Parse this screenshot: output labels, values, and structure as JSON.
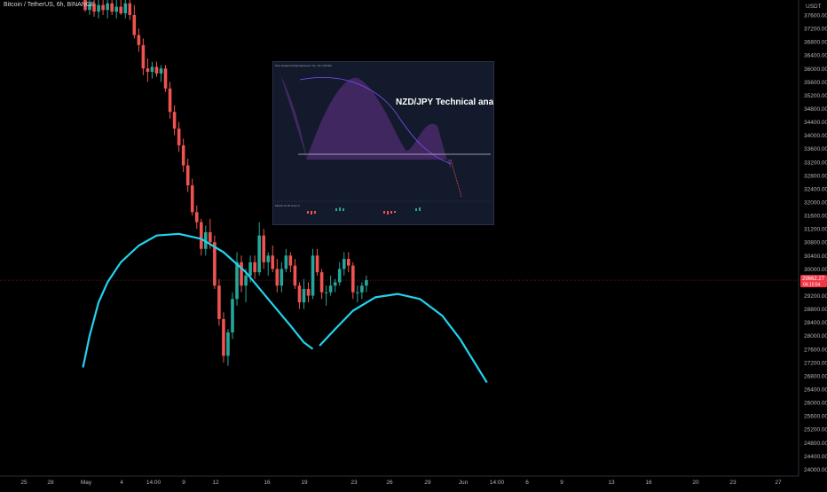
{
  "symbol_title": "Bitcoin / TetherUS, 6h, BINANCE",
  "currency": "USDT",
  "last_price": "29662.27",
  "last_sub": "04:15:54",
  "inset": {
    "title": "NZD/JPY Technical analysis",
    "header": "New Zealand Dollar/Japanese Yen, 1D, OANDA",
    "indicator": "MACD 12 26 close 9"
  },
  "colors": {
    "background": "#000000",
    "up": "#26a69a",
    "down": "#ef5350",
    "projection": "#22d3ee",
    "axis_text": "#b2b5be",
    "price_tag": "#f23645"
  },
  "chart_data": {
    "type": "candlestick",
    "y_axis": {
      "ticks": [
        24000,
        24400,
        24800,
        25200,
        25600,
        26000,
        26400,
        26800,
        27200,
        27600,
        28000,
        28400,
        28800,
        29200,
        29600,
        30000,
        30400,
        30800,
        31200,
        31600,
        32000,
        32400,
        32800,
        33200,
        33600,
        34000,
        34400,
        34800,
        35200,
        35600,
        36000,
        36400,
        36800,
        37200,
        37600
      ],
      "tick_labels": [
        "24000.00",
        "24400.00",
        "24800.00",
        "25200.00",
        "25600.00",
        "26000.00",
        "26400.00",
        "26800.00",
        "27200.00",
        "27600.00",
        "28000.00",
        "28400.00",
        "28800.00",
        "29200.00",
        "29600.00",
        "30000.00",
        "30400.00",
        "30800.00",
        "31200.00",
        "31600.00",
        "32000.00",
        "32400.00",
        "32800.00",
        "33200.00",
        "33600.00",
        "34000.00",
        "34400.00",
        "34800.00",
        "35200.00",
        "35600.00",
        "36000.00",
        "36400.00",
        "36800.00",
        "37200.00",
        "37600.00"
      ],
      "range": [
        23800,
        38050
      ]
    },
    "x_axis": {
      "labels": [
        "25",
        "28",
        "May",
        "4",
        "14:00",
        "9",
        "12",
        "16",
        "19",
        "23",
        "26",
        "29",
        "Jun",
        "14:00",
        "6",
        "9",
        "13",
        "16",
        "20",
        "23",
        "27"
      ],
      "dates": [
        "2021-04-25",
        "2021-04-28",
        "2021-05-01",
        "2021-05-04",
        "2021-05-07 14:00",
        "2021-05-09",
        "2021-05-12",
        "2021-05-16",
        "2021-05-19",
        "2021-05-23",
        "2021-05-26",
        "2021-05-29",
        "2021-06-01",
        "2021-06-03 14:00",
        "2021-06-06",
        "2021-06-09",
        "2021-06-13",
        "2021-06-16",
        "2021-06-20",
        "2021-06-23",
        "2021-06-27"
      ]
    },
    "candles": [
      [
        38050,
        38050,
        37700,
        37750
      ],
      [
        37750,
        38050,
        37600,
        37950
      ],
      [
        37950,
        38050,
        37550,
        37700
      ],
      [
        37700,
        38050,
        37500,
        37900
      ],
      [
        37900,
        38050,
        37600,
        37750
      ],
      [
        37750,
        38050,
        37500,
        37950
      ],
      [
        37950,
        38050,
        37600,
        37700
      ],
      [
        37700,
        38050,
        37500,
        37850
      ],
      [
        37850,
        38050,
        37600,
        37650
      ],
      [
        37650,
        38050,
        37500,
        37950
      ],
      [
        37950,
        38050,
        37450,
        37600
      ],
      [
        37600,
        37900,
        36900,
        37000
      ],
      [
        37000,
        37200,
        36500,
        36700
      ],
      [
        36700,
        36900,
        35800,
        36000
      ],
      [
        36000,
        36300,
        35600,
        35900
      ],
      [
        35900,
        36200,
        35700,
        36050
      ],
      [
        36050,
        36200,
        35750,
        35850
      ],
      [
        35850,
        36100,
        35600,
        36000
      ],
      [
        36000,
        36100,
        35300,
        35400
      ],
      [
        35400,
        35600,
        34500,
        34700
      ],
      [
        34700,
        34900,
        34000,
        34200
      ],
      [
        34200,
        34400,
        33500,
        33700
      ],
      [
        33700,
        33900,
        32900,
        33100
      ],
      [
        33100,
        33300,
        32300,
        32500
      ],
      [
        32500,
        32700,
        31600,
        31700
      ],
      [
        31700,
        31900,
        31200,
        31400
      ],
      [
        31400,
        31500,
        30400,
        30600
      ],
      [
        30600,
        31300,
        30400,
        31100
      ],
      [
        31100,
        31500,
        30600,
        30800
      ],
      [
        30800,
        31000,
        29400,
        29500
      ],
      [
        29500,
        29700,
        28300,
        28500
      ],
      [
        28500,
        28700,
        27200,
        27400
      ],
      [
        27400,
        28200,
        27100,
        28100
      ],
      [
        28100,
        29300,
        27900,
        29100
      ],
      [
        29100,
        30500,
        28900,
        30200
      ],
      [
        30200,
        30400,
        29300,
        29500
      ],
      [
        29500,
        30000,
        29000,
        29800
      ],
      [
        29800,
        30400,
        29600,
        30200
      ],
      [
        30200,
        30400,
        29700,
        29900
      ],
      [
        29900,
        31400,
        29800,
        31000
      ],
      [
        31000,
        31200,
        30000,
        30200
      ],
      [
        30200,
        30500,
        29800,
        30400
      ],
      [
        30400,
        30700,
        29900,
        30000
      ],
      [
        30000,
        30300,
        29300,
        29500
      ],
      [
        29500,
        30200,
        29300,
        30000
      ],
      [
        30000,
        30600,
        29900,
        30400
      ],
      [
        30400,
        30500,
        29900,
        30100
      ],
      [
        30100,
        30300,
        29400,
        29500
      ],
      [
        29500,
        29600,
        28800,
        29000
      ],
      [
        29000,
        29700,
        28800,
        29400
      ],
      [
        29400,
        29600,
        29000,
        29200
      ],
      [
        29200,
        30600,
        29100,
        30400
      ],
      [
        30400,
        30600,
        29800,
        29900
      ],
      [
        29900,
        30000,
        29100,
        29300
      ],
      [
        29300,
        29500,
        28900,
        29300
      ],
      [
        29300,
        29800,
        29200,
        29500
      ],
      [
        29500,
        29700,
        29300,
        29600
      ],
      [
        29600,
        30200,
        29500,
        30000
      ],
      [
        30000,
        30500,
        29800,
        30300
      ],
      [
        30300,
        30500,
        29900,
        30100
      ],
      [
        30100,
        30200,
        29100,
        29300
      ],
      [
        29300,
        29500,
        29000,
        29300
      ],
      [
        29300,
        29600,
        29100,
        29500
      ],
      [
        29500,
        29800,
        29300,
        29662.27
      ]
    ],
    "projection_path": [
      [
        -0.5,
        27050
      ],
      [
        1,
        28000
      ],
      [
        3,
        29000
      ],
      [
        5,
        29600
      ],
      [
        8,
        30200
      ],
      [
        12,
        30700
      ],
      [
        16,
        31000
      ],
      [
        21,
        31050
      ],
      [
        26,
        30900
      ],
      [
        31,
        30500
      ],
      [
        36,
        29900
      ],
      [
        41,
        29100
      ],
      [
        46,
        28300
      ],
      [
        49,
        27800
      ],
      [
        51,
        27600
      ],
      null,
      [
        52.5,
        27700
      ],
      [
        56,
        28200
      ],
      [
        60,
        28750
      ],
      [
        65,
        29150
      ],
      [
        70,
        29250
      ],
      [
        75,
        29100
      ],
      [
        80,
        28600
      ],
      [
        84,
        27900
      ],
      [
        87,
        27250
      ],
      [
        90,
        26600
      ]
    ]
  }
}
